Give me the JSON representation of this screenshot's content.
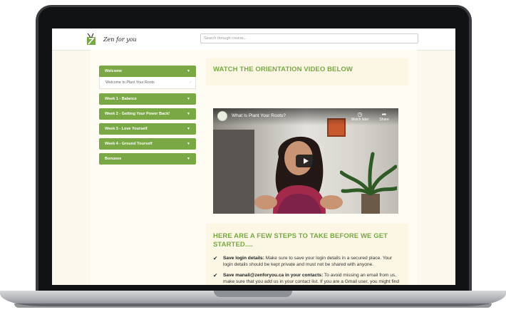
{
  "brand": {
    "name": "Zen for you"
  },
  "search": {
    "placeholder": "Search through course..."
  },
  "sidebar": {
    "modules": [
      {
        "label": "Welcome",
        "open": true,
        "lessons": [
          "Welcome to Plant Your Roots"
        ]
      },
      {
        "label": "Week 1 - Balance"
      },
      {
        "label": "Week 2 - Getting Your Power Back!"
      },
      {
        "label": "Week 3 - Love Yourself"
      },
      {
        "label": "Week 4 - Ground Yourself"
      },
      {
        "label": "Bonuses"
      }
    ]
  },
  "main": {
    "video_heading": "WATCH THE ORIENTATION VIDEO BELOW",
    "video": {
      "title": "What Is Plant Your Roots?",
      "watch_later": "Watch later",
      "share": "Share"
    },
    "steps_heading": "HERE ARE A FEW STEPS TO TAKE BEFORE WE GET STARTED....",
    "steps": [
      {
        "bold": "Save login details:",
        "text": " Make sure to save your login details in a secured place. Your login details should be kept private and must not be shared with anyone."
      },
      {
        "bold": "Save manali@zenforyou.ca in your contacts:",
        "text": " To avoid missing an email from us, make sure that you add us in your contact list. If you are a Gmail user, you might find out emails in your \"Promotions\" tab. Make sure to always check your spam folders just in case our emails land there."
      }
    ]
  },
  "colors": {
    "accent": "#7aa845",
    "panel": "#fbf7e4"
  }
}
